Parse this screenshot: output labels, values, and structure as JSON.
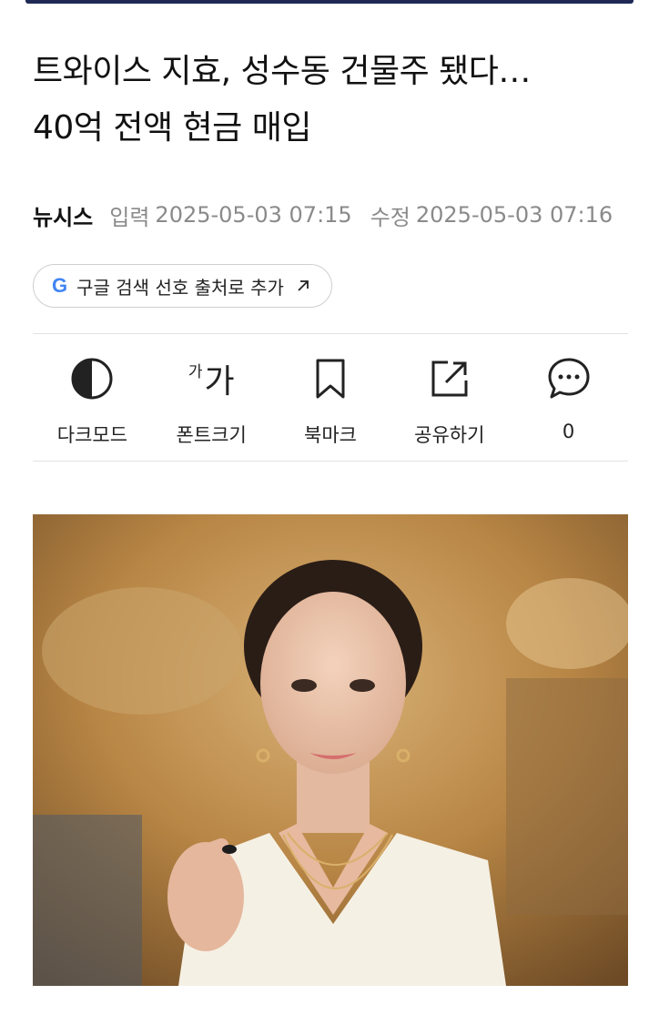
{
  "headline": {
    "line1": "트와이스 지효, 성수동 건물주 됐다…",
    "line2": "40억 전액 현금 매입"
  },
  "meta": {
    "press": "뉴시스",
    "input_label": "입력",
    "input_time": "2025-05-03 07:15",
    "edit_label": "수정",
    "edit_time": "2025-05-03 07:16"
  },
  "google_button": {
    "g": "G",
    "label": "구글 검색 선호 출처로 추가",
    "icon": "external-arrow-icon"
  },
  "toolbar": {
    "dark_mode": {
      "label": "다크모드",
      "icon": "half-circle-icon"
    },
    "font_size": {
      "label": "폰트크기",
      "small_glyph": "가",
      "big_glyph": "가"
    },
    "bookmark": {
      "label": "북마크",
      "icon": "bookmark-icon"
    },
    "share": {
      "label": "공유하기",
      "icon": "share-icon"
    },
    "comments": {
      "count": "0",
      "icon": "comment-bubble-icon"
    }
  },
  "colors": {
    "accent_blue": "#4285f4",
    "muted_text": "#8a8a8a",
    "divider": "#e2e2e2"
  }
}
